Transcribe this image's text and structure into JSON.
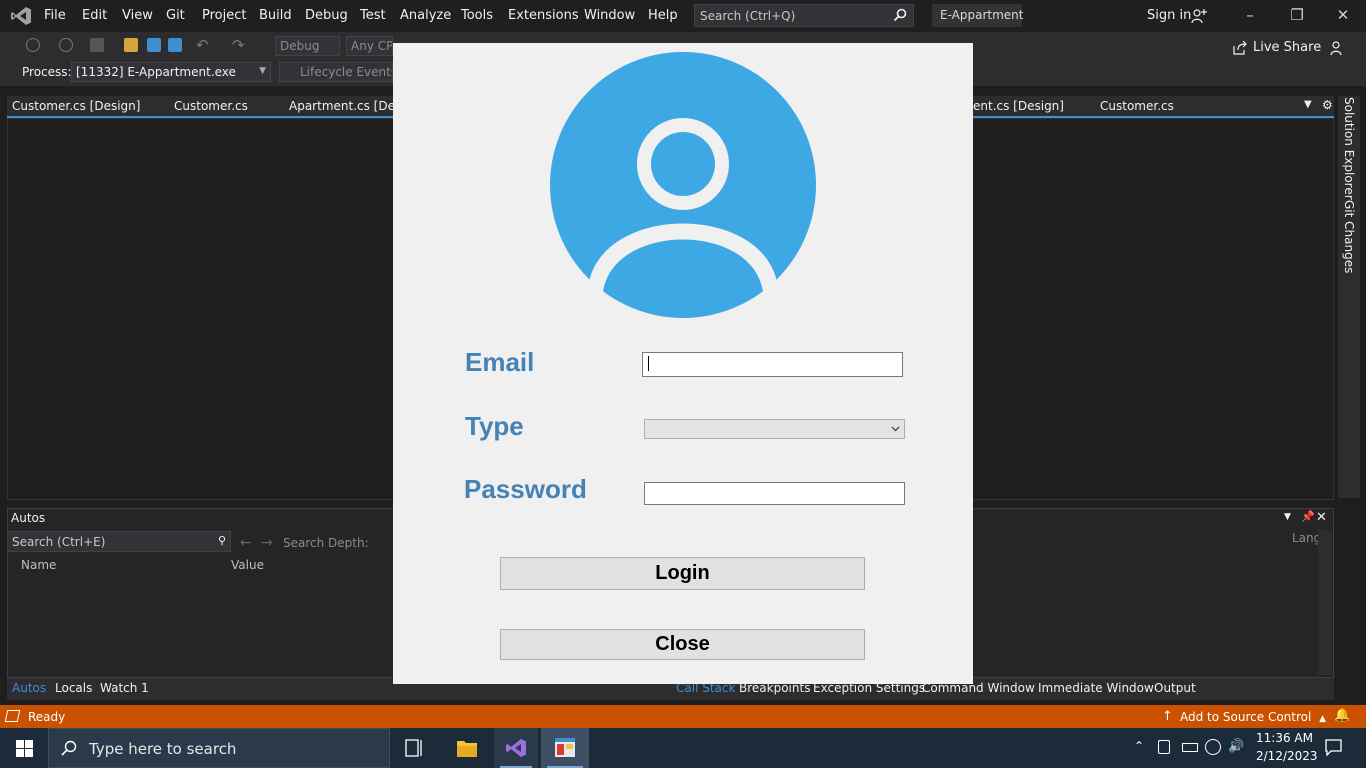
{
  "menu": {
    "items": [
      "File",
      "Edit",
      "View",
      "Git",
      "Project",
      "Build",
      "Debug",
      "Test",
      "Analyze",
      "Tools",
      "Extensions",
      "Window",
      "Help"
    ],
    "search_placeholder": "Search (Ctrl+Q)",
    "solution_name": "E-Appartment",
    "sign_in": "Sign in"
  },
  "toolbar": {
    "config": "Debug",
    "platform": "Any CPU",
    "live_share": "Live Share"
  },
  "toolbar2": {
    "process_label": "Process:",
    "process_value": "[11332] E-Appartment.exe",
    "lifecycle": "Lifecycle Events"
  },
  "tabs": [
    "Customer.cs [Design]",
    "Customer.cs",
    "Apartment.cs [Design]",
    "ent.cs [Design]",
    "Customer.cs"
  ],
  "side_rail": {
    "solution_explorer": "Solution Explorer",
    "git_changes": "Git Changes"
  },
  "autos": {
    "title": "Autos",
    "search_placeholder": "Search (Ctrl+E)",
    "search_depth": "Search Depth:",
    "col_name": "Name",
    "col_value": "Value",
    "col_lang": "Lang",
    "tabs_left": [
      "Autos",
      "Locals",
      "Watch 1"
    ],
    "tabs_right": [
      "Call Stack",
      "Breakpoints",
      "Exception Settings",
      "Command Window",
      "Immediate Window",
      "Output"
    ]
  },
  "status": {
    "text": "Ready",
    "source_control": "Add to Source Control"
  },
  "taskbar": {
    "search_placeholder": "Type here to search",
    "time": "11:36 AM",
    "date": "2/12/2023"
  },
  "login": {
    "email_label": "Email",
    "type_label": "Type",
    "password_label": "Password",
    "login_button": "Login",
    "close_button": "Close",
    "email_value": "",
    "type_value": "",
    "password_value": ""
  },
  "colors": {
    "accent_blue": "#3ea8e5",
    "label_blue": "#4682b4",
    "status_orange": "#ca5100"
  }
}
